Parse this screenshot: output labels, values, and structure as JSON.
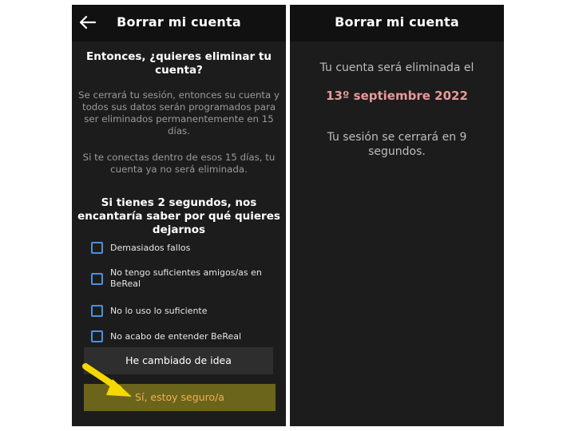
{
  "left_screen": {
    "title": "Borrar mi cuenta",
    "heading": "Entonces, ¿quieres eliminar tu cuenta?",
    "paragraph1": "Se cerrará tu sesión, entonces su cuenta y todos sus datos serán programados para ser eliminados permanentemente en 15 días.",
    "paragraph2": "Si te conectas dentro de esos 15 días, tu cuenta ya no será eliminada.",
    "survey_heading": "Si tienes 2 segundos, nos encantaría saber por qué quieres dejarnos",
    "reasons": [
      "Demasiados fallos",
      "No tengo suficientes amigos/as en BeReal",
      "No lo uso lo suficiente",
      "No acabo de entender BeReal"
    ],
    "change_mind_button": "He cambiado de idea",
    "confirm_button": "Sí, estoy seguro/a"
  },
  "right_screen": {
    "title": "Borrar mi cuenta",
    "deletion_text": "Tu cuenta será eliminada el",
    "deletion_date": "13º septiembre 2022",
    "logout_text": "Tu sesión se cerrará en 9 segundos."
  },
  "icons": {
    "back": "back-arrow-icon",
    "checkbox": "checkbox-icon",
    "pointer": "yellow-arrow-icon"
  },
  "colors": {
    "background": "#1c1c1c",
    "checkbox": "#4a90e2",
    "date": "#e89a96",
    "confirm_text": "#f0b04e",
    "confirm_bg": "#6b651c",
    "arrow": "#f5d800"
  }
}
